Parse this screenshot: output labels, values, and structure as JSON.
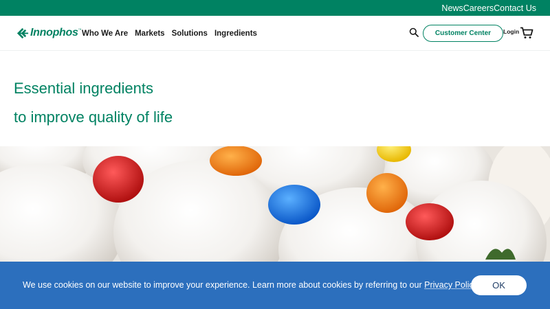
{
  "topbar": {
    "links": [
      "News",
      "Careers",
      "Contact Us"
    ]
  },
  "header": {
    "logo_text": "Innophos",
    "logo_tm": "™",
    "nav": [
      "Who We Are",
      "Markets",
      "Solutions",
      "Ingredients"
    ],
    "customer_center": "Customer Center",
    "login": "Login",
    "icons": {
      "search": "search-icon",
      "cart": "cart-icon"
    }
  },
  "hero": {
    "line1": "Essential ingredients",
    "line2": "to improve quality of life"
  },
  "cookie": {
    "message": "We use cookies on our website to improve your experience. Learn more about cookies by referring to our ",
    "link": "Privacy Policy",
    "period": ".",
    "ok": "OK"
  },
  "colors": {
    "brand_green": "#008262",
    "cookie_blue": "#2c6fbd",
    "text_dark": "#1a1a1a"
  }
}
